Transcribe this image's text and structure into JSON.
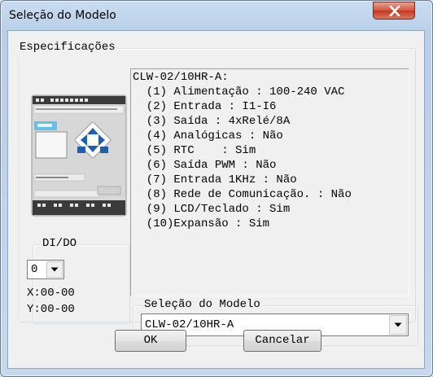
{
  "window": {
    "title": "Seleção do Modelo"
  },
  "specifications": {
    "group_label": "Especificações",
    "model_header": "CLW-02/10HR-A:",
    "lines": [
      "  (1) Alimentação : 100-240 VAC",
      "  (2) Entrada : I1-I6",
      "  (3) Saída : 4xRelé/8A",
      "  (4) Analógicas : Não",
      "  (5) RTC    : Sim",
      "  (6) Saída PWM : Não",
      "  (7) Entrada 1KHz : Não",
      "  (8) Rede de Comunicação. : Não",
      "  (9) LCD/Teclado : Sim",
      "  (10)Expansão : Sim"
    ]
  },
  "dido": {
    "group_label": "DI/DO",
    "selected_value": "0",
    "x_readout": "X:00-00",
    "y_readout": "Y:00-00"
  },
  "model_selection": {
    "group_label": "Seleção do Modelo",
    "selected_value": "CLW-02/10HR-A"
  },
  "buttons": {
    "ok_label": "OK",
    "cancel_label": "Cancelar"
  },
  "icons": {
    "close": "close-icon",
    "dropdown": "chevron-down-icon",
    "device": "plc-device-image"
  },
  "colors": {
    "close_button": "#c4361f",
    "window_frame": "#b9cfe8",
    "client_background": "#f0f0f0",
    "device_screen": "#5ec3e6",
    "device_keypad": "#1f5ea8"
  }
}
